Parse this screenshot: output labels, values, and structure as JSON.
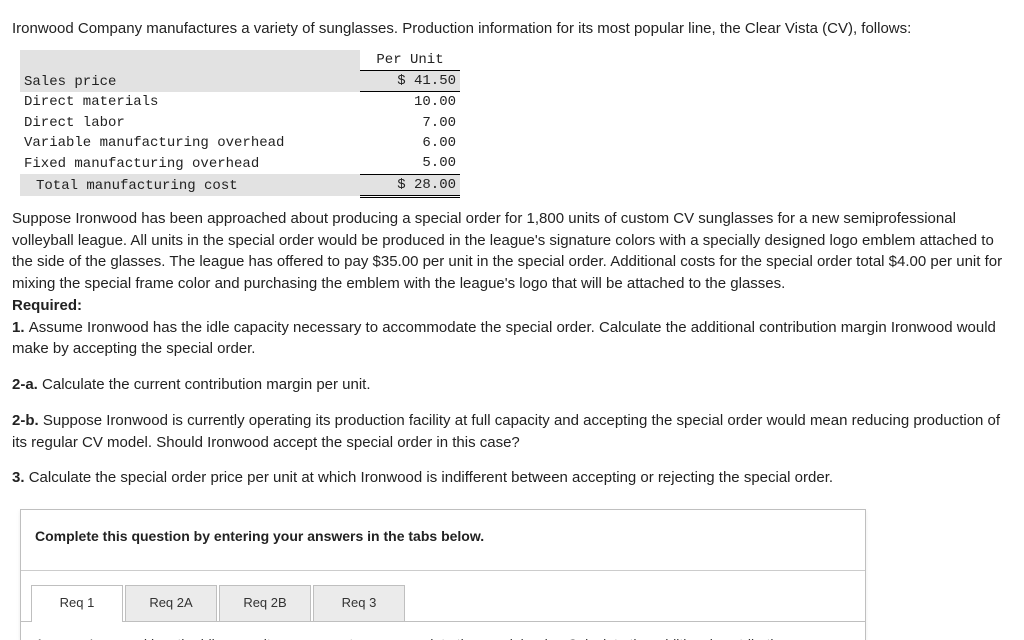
{
  "intro": "Ironwood Company manufactures a variety of sunglasses. Production information for its most popular line, the Clear Vista (CV), follows:",
  "cost_table": {
    "header": "Per Unit",
    "rows": [
      {
        "label": "Sales price",
        "value": "$ 41.50",
        "shaded": true,
        "rule": "underline"
      },
      {
        "label": "Direct materials",
        "value": "10.00",
        "shaded": false,
        "rule": "none"
      },
      {
        "label": "Direct labor",
        "value": "7.00",
        "shaded": false,
        "rule": "none"
      },
      {
        "label": "Variable manufacturing overhead",
        "value": "6.00",
        "shaded": false,
        "rule": "none"
      },
      {
        "label": "Fixed manufacturing overhead",
        "value": "5.00",
        "shaded": false,
        "rule": "underline"
      },
      {
        "label": "Total manufacturing cost",
        "value": "$ 28.00",
        "shaded": true,
        "rule": "double",
        "indent": true
      }
    ]
  },
  "scenario": "Suppose Ironwood has been approached about producing a special order for 1,800 units of custom CV sunglasses for a new semiprofessional volleyball league. All units in the special order would be produced in the league's signature colors with a specially designed logo emblem attached to the side of the glasses. The league has offered to pay $35.00 per unit in the special order. Additional costs for the special order total $4.00 per unit for mixing the special frame color and purchasing the emblem with the league's logo that will be attached to the glasses.",
  "required_label": "Required:",
  "q1_prefix": "1. ",
  "q1_text": "Assume Ironwood has the idle capacity necessary to accommodate the special order. Calculate the additional contribution margin Ironwood would make by accepting the special order.",
  "q2a_prefix": "2-a. ",
  "q2a_text": "Calculate the current contribution margin per unit.",
  "q2b_prefix": "2-b. ",
  "q2b_text": "Suppose Ironwood is currently operating its production facility at full capacity and accepting the special order would mean reducing production of its regular CV model. Should Ironwood accept the special order in this case?",
  "q3_prefix": "3. ",
  "q3_text": "Calculate the special order price per unit at which Ironwood is indifferent between accepting or rejecting the special order.",
  "panel": {
    "instruction": "Complete this question by entering your answers in the tabs below.",
    "tabs": [
      "Req 1",
      "Req 2A",
      "Req 2B",
      "Req 3"
    ],
    "active_tab": 0,
    "body_preview": "Assume Ironwood has the idle capacity necessary to accommodate the special order. Calculate the additional contribution"
  }
}
